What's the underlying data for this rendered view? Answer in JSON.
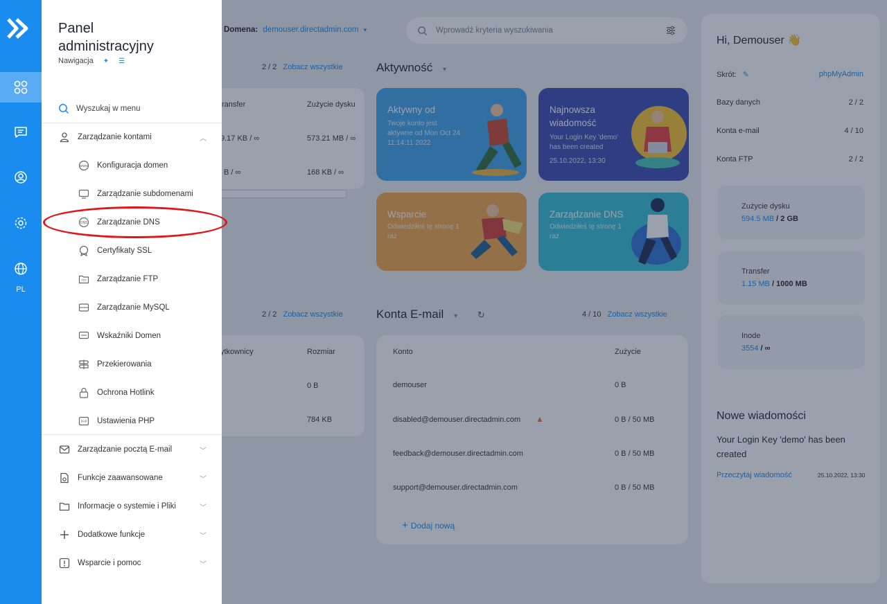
{
  "rail": {
    "lang": "PL"
  },
  "drawer": {
    "title_line1": "Panel",
    "title_line2": "administracyjny",
    "subtitle": "Nawigacja",
    "search": "Wyszukaj w menu",
    "account_mgmt": "Zarządzanie kontami",
    "sub_items": [
      {
        "label": "Konfiguracja domen"
      },
      {
        "label": "Zarządzanie subdomenami"
      },
      {
        "label": "Zarządzanie DNS"
      },
      {
        "label": "Certyfikaty SSL"
      },
      {
        "label": "Zarządzanie FTP"
      },
      {
        "label": "Zarządzanie MySQL"
      },
      {
        "label": "Wskaźniki Domen"
      },
      {
        "label": "Przekierowania"
      },
      {
        "label": "Ochrona Hotlink"
      },
      {
        "label": "Ustawienia PHP"
      }
    ],
    "sections": [
      {
        "label": "Zarządzanie pocztą E-mail"
      },
      {
        "label": "Funkcje zaawansowane"
      },
      {
        "label": "Informacje o systemie i Pliki"
      },
      {
        "label": "Dodatkowe funkcje"
      },
      {
        "label": "Wsparcie i pomoc"
      }
    ]
  },
  "topbar": {
    "domain_label": "Domena:",
    "domain_value": "demouser.directadmin.com",
    "search_placeholder": "Wprowadź kryteria wyszukiwania"
  },
  "domains_table": {
    "count": "2 / 2",
    "see_all": "Zobacz wszystkie",
    "col_transfer": "ransfer",
    "col_disk": "Zużycie dysku",
    "rows": [
      {
        "transfer": "9.17 KB / ∞",
        "disk": "573.21 MB / ∞"
      },
      {
        "transfer": "B / ∞",
        "disk": "168 KB / ∞"
      }
    ]
  },
  "activity": {
    "title": "Aktywność",
    "cards": [
      {
        "title": "Aktywny od",
        "body1": "Twoje konto jest",
        "body2": "aktywne od Mon Oct 24",
        "body3": "11:14:11 2022"
      },
      {
        "title": "Najnowsza wiadomość",
        "body1": "Your Login Key 'demo'",
        "body2": "has been created",
        "body3": "25.10.2022, 13:30"
      },
      {
        "title": "Wsparcie",
        "body1": "Odwiedziłeś tę stronę 1",
        "body2": "raz"
      },
      {
        "title": "Zarządzanie DNS",
        "body1": "Odwiedziłeś tę stronę 1",
        "body2": "raz"
      }
    ]
  },
  "db_table": {
    "count": "2 / 2",
    "see_all": "Zobacz wszystkie",
    "col_users": "ytkownicy",
    "col_size": "Rozmiar",
    "rows": [
      {
        "size": "0 B"
      },
      {
        "size": "784 KB"
      }
    ]
  },
  "email": {
    "title": "Konta E-mail",
    "count": "4 / 10",
    "see_all": "Zobacz wszystkie",
    "col_account": "Konto",
    "col_usage": "Zużycie",
    "rows": [
      {
        "account": "demouser",
        "usage": "0 B"
      },
      {
        "account": "disabled@demouser.directadmin.com",
        "usage": "0 B / 50 MB"
      },
      {
        "account": "feedback@demouser.directadmin.com",
        "usage": "0 B / 50 MB"
      },
      {
        "account": "support@demouser.directadmin.com",
        "usage": "0 B / 50 MB"
      }
    ],
    "add_new": "Dodaj nową"
  },
  "right": {
    "greeting": "Hi, Demouser 👋",
    "shortcut_label": "Skrót:",
    "shortcut_value": "phpMyAdmin",
    "databases_label": "Bazy danych",
    "databases_value": "2 / 2",
    "email_label": "Konta e-mail",
    "email_value": "4 / 10",
    "ftp_label": "Konta FTP",
    "ftp_value": "2 / 2",
    "disk_label": "Zużycie dysku",
    "disk_used": "594.5 MB",
    "disk_total": "/ 2 GB",
    "transfer_label": "Transfer",
    "transfer_used": "1.15 MB",
    "transfer_total": "/ 1000 MB",
    "inode_label": "Inode",
    "inode_used": "3554",
    "inode_total": "/ ∞",
    "messages_title": "Nowe wiadomości",
    "message_text": "Your Login Key 'demo' has been created",
    "read_link": "Przeczytaj wiadomość",
    "message_date": "25.10.2022, 13:30"
  },
  "colors": {
    "accent": "#1a8bef",
    "highlight": "#e0161b",
    "activity_blue": "#3fa4ee",
    "activity_purple": "#3b4bb3",
    "activity_orange": "#f0a748",
    "activity_teal": "#36c0d8"
  }
}
